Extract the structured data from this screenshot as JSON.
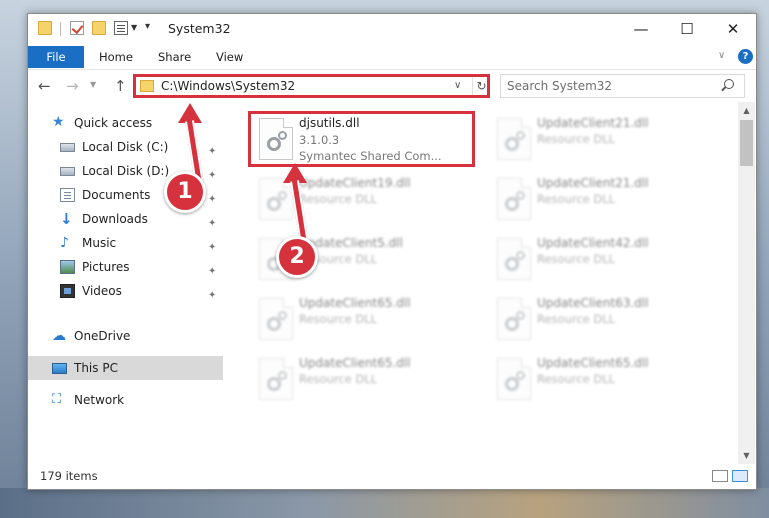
{
  "window": {
    "title": "System32"
  },
  "ribbon": {
    "file": "File",
    "home": "Home",
    "share": "Share",
    "view": "View",
    "help": "?"
  },
  "address": {
    "path": "C:\\Windows\\System32"
  },
  "search": {
    "placeholder": "Search System32"
  },
  "sidebar": {
    "items": [
      {
        "label": "Quick access",
        "icon": "star-icon"
      },
      {
        "label": "Local Disk (C:)",
        "icon": "drive-icon"
      },
      {
        "label": "Local Disk (D:)",
        "icon": "drive-icon"
      },
      {
        "label": "Documents",
        "icon": "documents-icon"
      },
      {
        "label": "Downloads",
        "icon": "download-icon"
      },
      {
        "label": "Music",
        "icon": "music-icon"
      },
      {
        "label": "Pictures",
        "icon": "pictures-icon"
      },
      {
        "label": "Videos",
        "icon": "videos-icon"
      },
      {
        "label": "OneDrive",
        "icon": "cloud-icon"
      },
      {
        "label": "This PC",
        "icon": "computer-icon"
      },
      {
        "label": "Network",
        "icon": "network-icon"
      }
    ]
  },
  "files": [
    {
      "name": "djsutils.dll",
      "version": "3.1.0.3",
      "company": "Symantec Shared Com..."
    },
    {
      "name": "UpdateClient21.dll",
      "desc": "Resource DLL"
    },
    {
      "name": "UpdateClient19.dll",
      "desc": "Resource DLL"
    },
    {
      "name": "UpdateClient21.dll",
      "desc": "Resource DLL"
    },
    {
      "name": "UpdateClient5.dll",
      "desc": "Resource DLL"
    },
    {
      "name": "UpdateClient42.dll",
      "desc": "Resource DLL"
    },
    {
      "name": "UpdateClient65.dll",
      "desc": "Resource DLL"
    },
    {
      "name": "UpdateClient63.dll",
      "desc": "Resource DLL"
    },
    {
      "name": "UpdateClient65.dll",
      "desc": "Resource DLL"
    },
    {
      "name": "UpdateClient65.dll",
      "desc": "Resource DLL"
    }
  ],
  "status": {
    "count": "179 items"
  },
  "callouts": {
    "one": "1",
    "two": "2"
  },
  "colors": {
    "accent": "#1a6fc4",
    "annotation": "#d6323d",
    "selection": "#d9d9d9"
  }
}
